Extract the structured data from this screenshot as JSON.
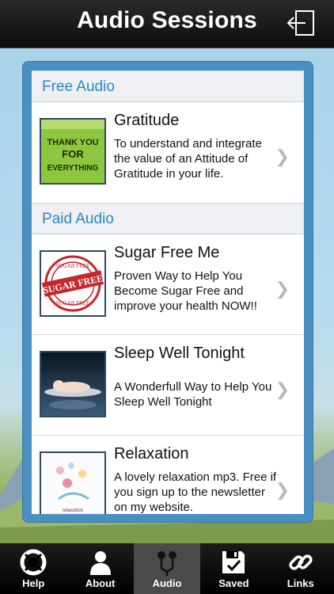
{
  "nav": {
    "title": "Audio Sessions"
  },
  "sections": [
    {
      "header": "Free Audio",
      "items": [
        {
          "title": "Gratitude",
          "description": "To understand and integrate the value of an Attitude of Gratitude in your life.",
          "thumb_text": [
            "THANK YOU",
            "FOR",
            "EVERYTHING"
          ]
        }
      ]
    },
    {
      "header": "Paid Audio",
      "items": [
        {
          "title": "Sugar Free Me",
          "description": "Proven Way to Help You Become Sugar Free and improve your health NOW!!",
          "thumb_text": [
            "SUGAR FREE",
            "SUGAR FREE",
            "SUGAR FREE"
          ]
        },
        {
          "title": "Sleep Well Tonight",
          "description": "A Wonderfull Way to Help You Sleep Well Tonight"
        },
        {
          "title": "Relaxation",
          "description": "A lovely relaxation mp3. Free if you sign up to the newsletter on my website.",
          "thumb_text": [
            "relaxation"
          ]
        }
      ]
    }
  ],
  "tabs": [
    {
      "label": "Help",
      "icon": "lifebuoy-icon"
    },
    {
      "label": "About",
      "icon": "person-icon"
    },
    {
      "label": "Audio",
      "icon": "earphones-icon",
      "active": true
    },
    {
      "label": "Saved",
      "icon": "save-disk-icon"
    },
    {
      "label": "Links",
      "icon": "chain-link-icon"
    }
  ],
  "colors": {
    "section_header_text": "#2f86c7",
    "panel": "#4a8fc2",
    "nav_bg": "#0c0c0c"
  }
}
